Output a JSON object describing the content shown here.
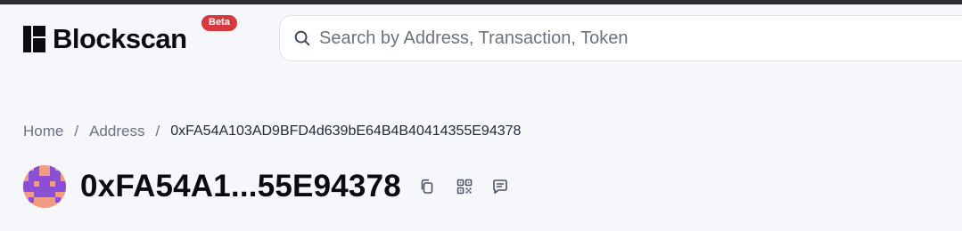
{
  "header": {
    "brand": "Blockscan",
    "beta_badge": "Beta",
    "search_placeholder": "Search by Address, Transaction, Token"
  },
  "breadcrumb": {
    "home": "Home",
    "separator": "/",
    "section": "Address",
    "current": "0xFA54A103AD9BFD4d639bE64B4B40414355E94378"
  },
  "address": {
    "short": "0xFA54A1...55E94378"
  },
  "icons": {
    "search": "search-icon",
    "copy": "copy-icon",
    "qr": "qr-code-icon",
    "chat": "chat-icon"
  },
  "colors": {
    "beta_badge": "#d63a3f",
    "avatar_bg": "#f29a82",
    "avatar_pattern": "#8b4fd6",
    "background": "#f6f7fb"
  }
}
